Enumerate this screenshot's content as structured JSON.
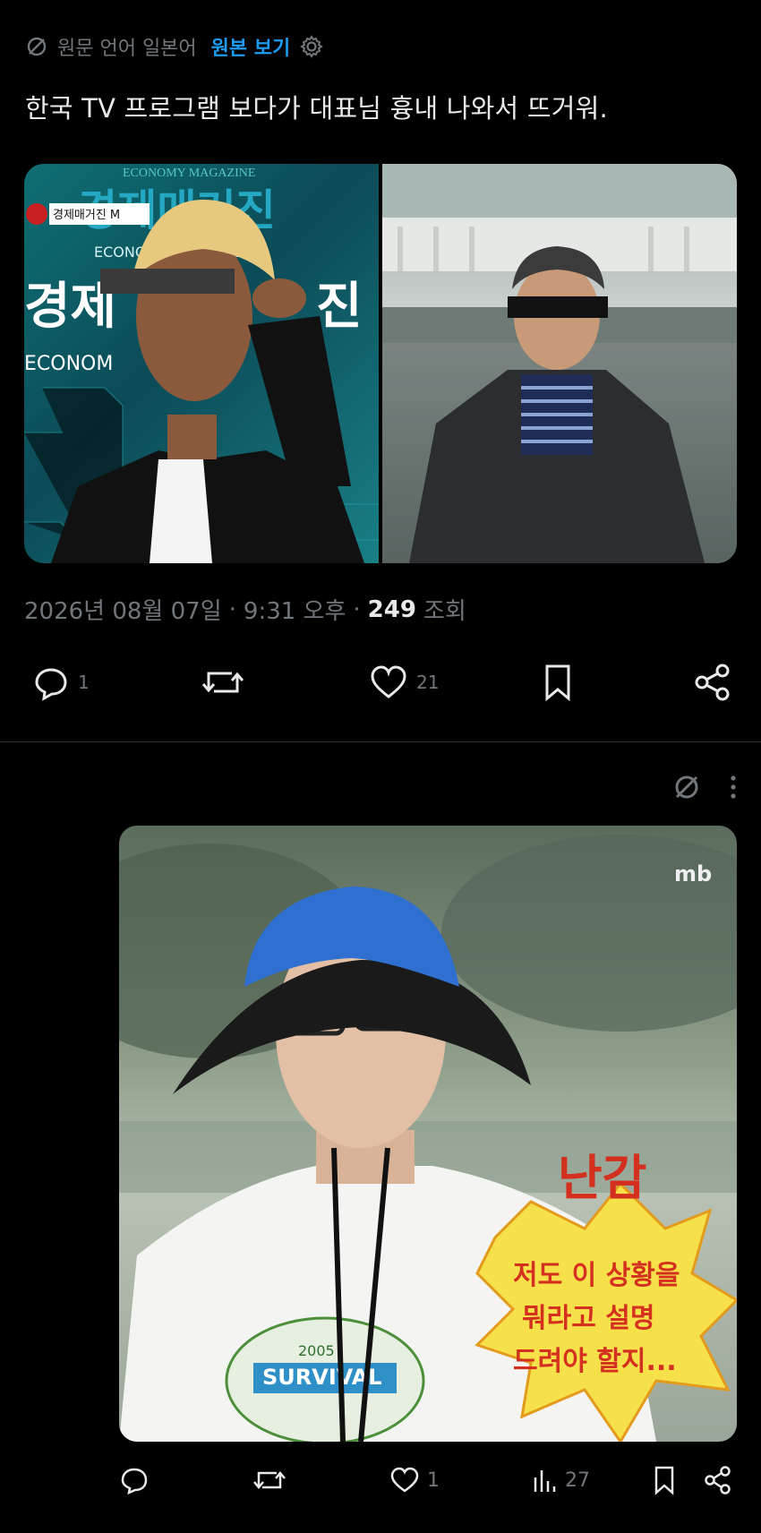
{
  "translate": {
    "label": "원문 언어 일본어",
    "link": "원본 보기",
    "icon": "translate-off-icon",
    "settings_icon": "gear-icon"
  },
  "tweet": {
    "text": "한국 TV 프로그램 보다가 대표님 흉내 나와서 뜨거워.",
    "images": {
      "left": {
        "channel_badge": "경제매거진 M",
        "bg_line1": "경제매거진",
        "bg_line2": "ECONOMY MAGAZINE",
        "bg_line3": "경제",
        "bg_line4": "진",
        "bg_line5": "ECONOM",
        "top_small": "ECONOMY MAGAZINE"
      }
    },
    "meta": {
      "date": "2026년 08월 07일",
      "time": "9:31 오후",
      "views_count": "249",
      "views_label": "조회"
    },
    "actions": {
      "reply_count": "1",
      "retweet_count": "",
      "like_count": "21"
    }
  },
  "reply": {
    "icons": [
      "translate-off-icon",
      "more-icon"
    ],
    "image": {
      "logo": "mb",
      "caption_title": "난감",
      "caption_line1": "저도 이 상황을",
      "caption_line2": "뭐라고 설명",
      "caption_line3": "드려야 할지...",
      "shirt_text": "SURVIVAL",
      "shirt_year": "2005"
    },
    "actions": {
      "reply_count": "",
      "retweet_count": "",
      "like_count": "1",
      "views_count": "27"
    }
  },
  "colors": {
    "accent": "#1d9bf0",
    "muted": "#71767b",
    "text": "#e7e9ea"
  }
}
